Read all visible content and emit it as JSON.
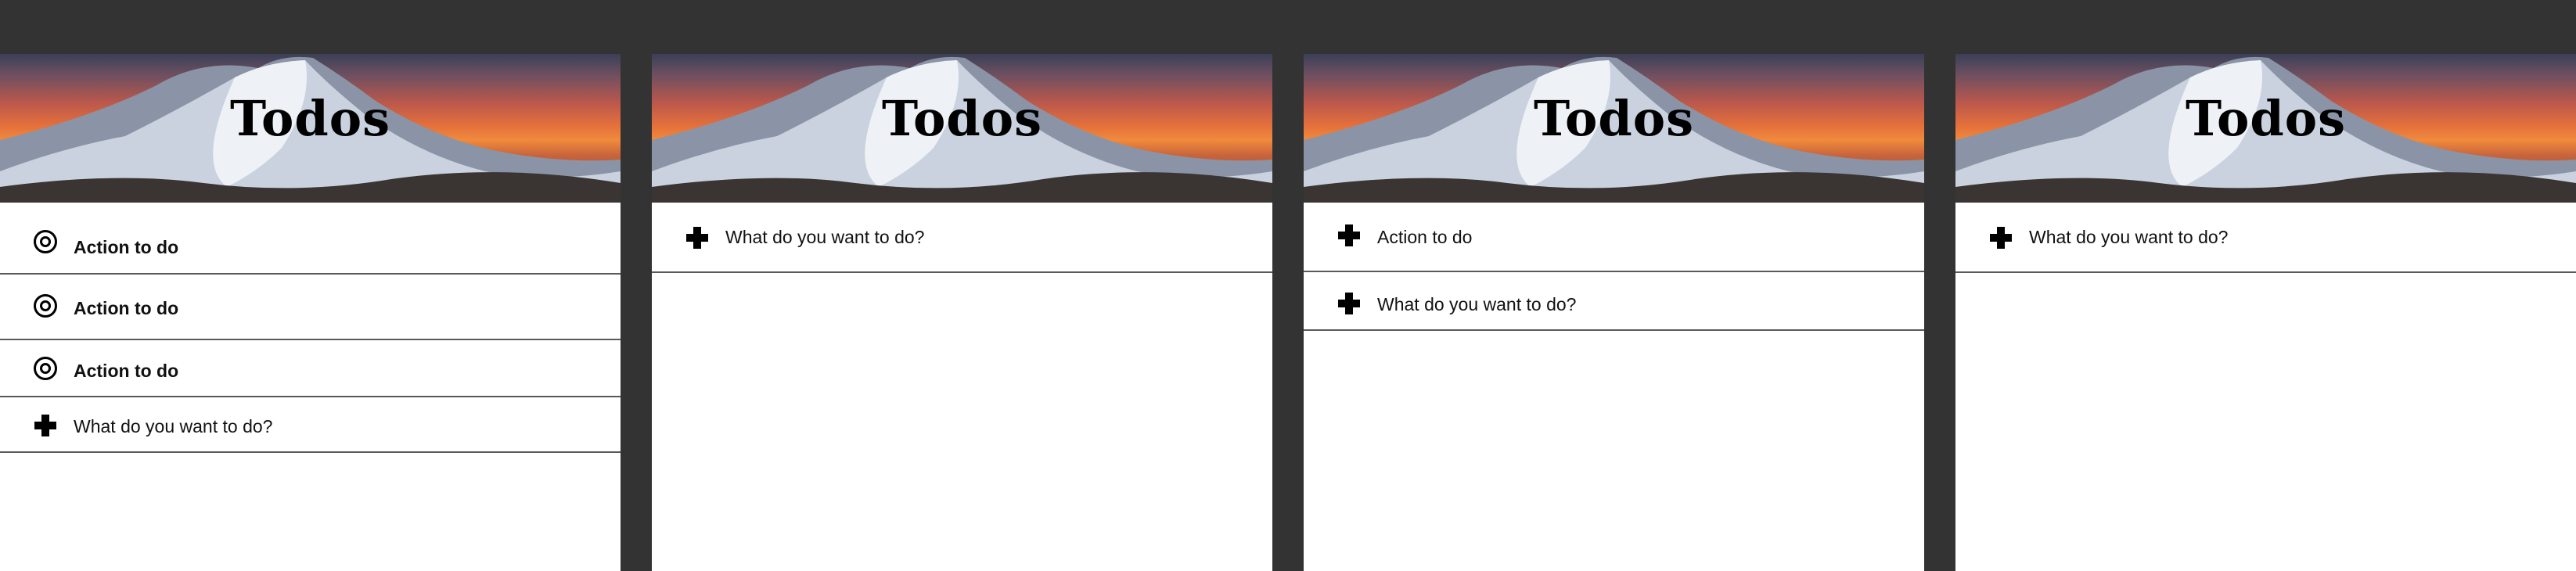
{
  "app": {
    "title": "Todos"
  },
  "panels": [
    {
      "items": [
        {
          "label": "Action to do",
          "icon": "target-circle-icon"
        },
        {
          "label": "Action to do",
          "icon": "target-circle-icon"
        },
        {
          "label": "Action to do",
          "icon": "target-circle-icon"
        }
      ],
      "new_item": {
        "placeholder": "What do you want to do?",
        "icon": "plus-icon"
      }
    },
    {
      "items": [],
      "new_item": {
        "placeholder": "What do you want to do?",
        "icon": "plus-icon"
      }
    },
    {
      "items": [
        {
          "label": "Action to do",
          "icon": "plus-icon"
        }
      ],
      "new_item": {
        "placeholder": "What do you want to do?",
        "icon": "plus-icon"
      }
    },
    {
      "items": [],
      "new_item": {
        "placeholder": "What do you want to do?",
        "icon": "plus-icon"
      }
    }
  ],
  "colors": {
    "frame": "#333333",
    "panel": "#ffffff",
    "divider": "#5a5a5a",
    "text": "#111111"
  }
}
